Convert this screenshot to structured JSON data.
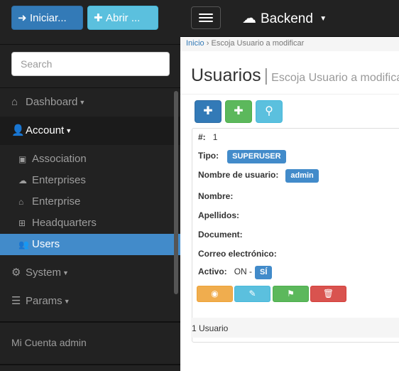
{
  "sidebar": {
    "login_button": {
      "icon": "sign-in-icon",
      "label": "Iniciar..."
    },
    "open_button": {
      "icon": "plus-icon",
      "label": "Abrir ..."
    },
    "search": {
      "placeholder": "Search"
    },
    "nav": [
      {
        "label": "Dashboard",
        "icon": "home-icon"
      },
      {
        "label": "Account",
        "icon": "user-icon"
      },
      {
        "label": "System",
        "icon": "cogs-icon"
      },
      {
        "label": "Params",
        "icon": "list-icon"
      }
    ],
    "account_items": [
      {
        "label": "Association",
        "icon": "building-icon"
      },
      {
        "label": "Enterprises",
        "icon": "cloud-icon"
      },
      {
        "label": "Enterprise",
        "icon": "bank-icon"
      },
      {
        "label": "Headquarters",
        "icon": "sitemap-icon"
      },
      {
        "label": "Users",
        "icon": "users-icon",
        "active": true
      }
    ],
    "my_account": "Mi Cuenta admin"
  },
  "topbar": {
    "brand": "Backend",
    "brand_icon": "cloud-icon"
  },
  "breadcrumb": {
    "home": "Inicio",
    "separator": "›",
    "current": "Escoja Usuario a modificar"
  },
  "page": {
    "title": "Usuarios",
    "subtitle": "Escoja Usuario a modificar"
  },
  "record": {
    "id_label": "#:",
    "id_value": "1",
    "tipo_label": "Tipo:",
    "tipo_value": "SUPERUSER",
    "username_label": "Nombre de usuario:",
    "username_value": "admin",
    "nombre_label": "Nombre:",
    "apellidos_label": "Apellidos:",
    "document_label": "Document:",
    "email_label": "Correo electrónico:",
    "activo_label": "Activo:",
    "activo_text": "ON -",
    "activo_value": "SÍ"
  },
  "footer": {
    "count": "1 Usuario"
  },
  "colors": {
    "sidebar_bg": "#222222",
    "active_item": "#428bca",
    "primary": "#337ab7",
    "success": "#5cb85c",
    "info": "#5bc0de",
    "warning": "#f0ad4e",
    "danger": "#d9534f"
  }
}
